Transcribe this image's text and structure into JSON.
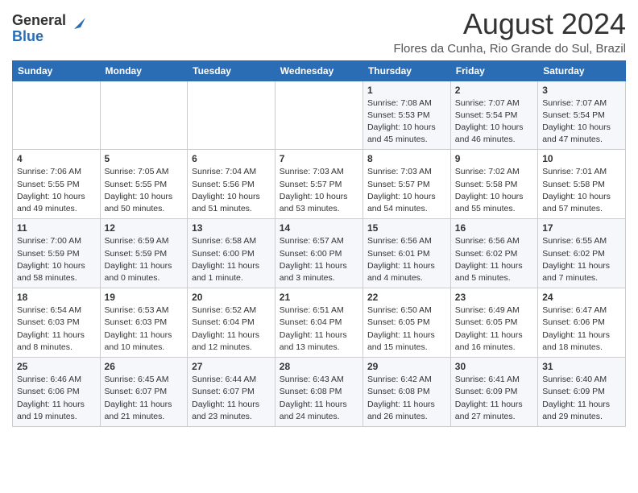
{
  "header": {
    "logo_general": "General",
    "logo_blue": "Blue",
    "title": "August 2024",
    "location": "Flores da Cunha, Rio Grande do Sul, Brazil"
  },
  "weekdays": [
    "Sunday",
    "Monday",
    "Tuesday",
    "Wednesday",
    "Thursday",
    "Friday",
    "Saturday"
  ],
  "weeks": [
    [
      {
        "day": "",
        "sunrise": "",
        "sunset": "",
        "daylight": ""
      },
      {
        "day": "",
        "sunrise": "",
        "sunset": "",
        "daylight": ""
      },
      {
        "day": "",
        "sunrise": "",
        "sunset": "",
        "daylight": ""
      },
      {
        "day": "",
        "sunrise": "",
        "sunset": "",
        "daylight": ""
      },
      {
        "day": "1",
        "sunrise": "Sunrise: 7:08 AM",
        "sunset": "Sunset: 5:53 PM",
        "daylight": "Daylight: 10 hours and 45 minutes."
      },
      {
        "day": "2",
        "sunrise": "Sunrise: 7:07 AM",
        "sunset": "Sunset: 5:54 PM",
        "daylight": "Daylight: 10 hours and 46 minutes."
      },
      {
        "day": "3",
        "sunrise": "Sunrise: 7:07 AM",
        "sunset": "Sunset: 5:54 PM",
        "daylight": "Daylight: 10 hours and 47 minutes."
      }
    ],
    [
      {
        "day": "4",
        "sunrise": "Sunrise: 7:06 AM",
        "sunset": "Sunset: 5:55 PM",
        "daylight": "Daylight: 10 hours and 49 minutes."
      },
      {
        "day": "5",
        "sunrise": "Sunrise: 7:05 AM",
        "sunset": "Sunset: 5:55 PM",
        "daylight": "Daylight: 10 hours and 50 minutes."
      },
      {
        "day": "6",
        "sunrise": "Sunrise: 7:04 AM",
        "sunset": "Sunset: 5:56 PM",
        "daylight": "Daylight: 10 hours and 51 minutes."
      },
      {
        "day": "7",
        "sunrise": "Sunrise: 7:03 AM",
        "sunset": "Sunset: 5:57 PM",
        "daylight": "Daylight: 10 hours and 53 minutes."
      },
      {
        "day": "8",
        "sunrise": "Sunrise: 7:03 AM",
        "sunset": "Sunset: 5:57 PM",
        "daylight": "Daylight: 10 hours and 54 minutes."
      },
      {
        "day": "9",
        "sunrise": "Sunrise: 7:02 AM",
        "sunset": "Sunset: 5:58 PM",
        "daylight": "Daylight: 10 hours and 55 minutes."
      },
      {
        "day": "10",
        "sunrise": "Sunrise: 7:01 AM",
        "sunset": "Sunset: 5:58 PM",
        "daylight": "Daylight: 10 hours and 57 minutes."
      }
    ],
    [
      {
        "day": "11",
        "sunrise": "Sunrise: 7:00 AM",
        "sunset": "Sunset: 5:59 PM",
        "daylight": "Daylight: 10 hours and 58 minutes."
      },
      {
        "day": "12",
        "sunrise": "Sunrise: 6:59 AM",
        "sunset": "Sunset: 5:59 PM",
        "daylight": "Daylight: 11 hours and 0 minutes."
      },
      {
        "day": "13",
        "sunrise": "Sunrise: 6:58 AM",
        "sunset": "Sunset: 6:00 PM",
        "daylight": "Daylight: 11 hours and 1 minute."
      },
      {
        "day": "14",
        "sunrise": "Sunrise: 6:57 AM",
        "sunset": "Sunset: 6:00 PM",
        "daylight": "Daylight: 11 hours and 3 minutes."
      },
      {
        "day": "15",
        "sunrise": "Sunrise: 6:56 AM",
        "sunset": "Sunset: 6:01 PM",
        "daylight": "Daylight: 11 hours and 4 minutes."
      },
      {
        "day": "16",
        "sunrise": "Sunrise: 6:56 AM",
        "sunset": "Sunset: 6:02 PM",
        "daylight": "Daylight: 11 hours and 5 minutes."
      },
      {
        "day": "17",
        "sunrise": "Sunrise: 6:55 AM",
        "sunset": "Sunset: 6:02 PM",
        "daylight": "Daylight: 11 hours and 7 minutes."
      }
    ],
    [
      {
        "day": "18",
        "sunrise": "Sunrise: 6:54 AM",
        "sunset": "Sunset: 6:03 PM",
        "daylight": "Daylight: 11 hours and 8 minutes."
      },
      {
        "day": "19",
        "sunrise": "Sunrise: 6:53 AM",
        "sunset": "Sunset: 6:03 PM",
        "daylight": "Daylight: 11 hours and 10 minutes."
      },
      {
        "day": "20",
        "sunrise": "Sunrise: 6:52 AM",
        "sunset": "Sunset: 6:04 PM",
        "daylight": "Daylight: 11 hours and 12 minutes."
      },
      {
        "day": "21",
        "sunrise": "Sunrise: 6:51 AM",
        "sunset": "Sunset: 6:04 PM",
        "daylight": "Daylight: 11 hours and 13 minutes."
      },
      {
        "day": "22",
        "sunrise": "Sunrise: 6:50 AM",
        "sunset": "Sunset: 6:05 PM",
        "daylight": "Daylight: 11 hours and 15 minutes."
      },
      {
        "day": "23",
        "sunrise": "Sunrise: 6:49 AM",
        "sunset": "Sunset: 6:05 PM",
        "daylight": "Daylight: 11 hours and 16 minutes."
      },
      {
        "day": "24",
        "sunrise": "Sunrise: 6:47 AM",
        "sunset": "Sunset: 6:06 PM",
        "daylight": "Daylight: 11 hours and 18 minutes."
      }
    ],
    [
      {
        "day": "25",
        "sunrise": "Sunrise: 6:46 AM",
        "sunset": "Sunset: 6:06 PM",
        "daylight": "Daylight: 11 hours and 19 minutes."
      },
      {
        "day": "26",
        "sunrise": "Sunrise: 6:45 AM",
        "sunset": "Sunset: 6:07 PM",
        "daylight": "Daylight: 11 hours and 21 minutes."
      },
      {
        "day": "27",
        "sunrise": "Sunrise: 6:44 AM",
        "sunset": "Sunset: 6:07 PM",
        "daylight": "Daylight: 11 hours and 23 minutes."
      },
      {
        "day": "28",
        "sunrise": "Sunrise: 6:43 AM",
        "sunset": "Sunset: 6:08 PM",
        "daylight": "Daylight: 11 hours and 24 minutes."
      },
      {
        "day": "29",
        "sunrise": "Sunrise: 6:42 AM",
        "sunset": "Sunset: 6:08 PM",
        "daylight": "Daylight: 11 hours and 26 minutes."
      },
      {
        "day": "30",
        "sunrise": "Sunrise: 6:41 AM",
        "sunset": "Sunset: 6:09 PM",
        "daylight": "Daylight: 11 hours and 27 minutes."
      },
      {
        "day": "31",
        "sunrise": "Sunrise: 6:40 AM",
        "sunset": "Sunset: 6:09 PM",
        "daylight": "Daylight: 11 hours and 29 minutes."
      }
    ]
  ]
}
